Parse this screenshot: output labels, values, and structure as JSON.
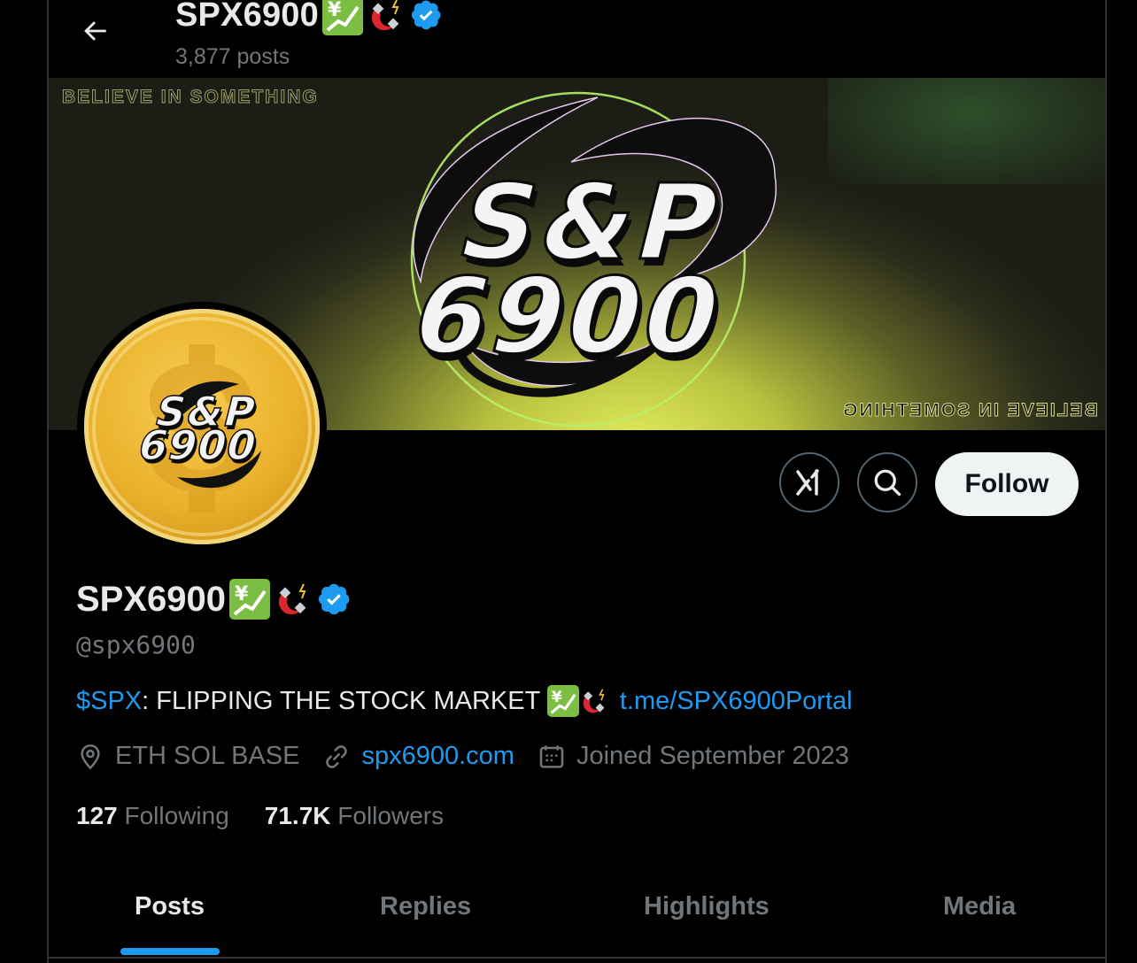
{
  "header": {
    "back_icon": "arrow-left-icon",
    "title": "SPX6900",
    "posts_count": "3,877 posts"
  },
  "banner": {
    "text_top": "BELIEVE IN SOMETHING",
    "text_bottom": "BELIEVE IN SOMETHING",
    "logo_line1": "S&P",
    "logo_line2": "6900",
    "accent": "#dfe85a"
  },
  "avatar": {
    "logo_line1": "S&P",
    "logo_line2": "6900",
    "color": "#eab12b"
  },
  "actions": {
    "grok_icon": "grok-icon",
    "search_icon": "search-icon",
    "follow_label": "Follow"
  },
  "profile": {
    "display_name": "SPX6900",
    "handle": "@spx6900",
    "bio_ticker": "$SPX",
    "bio_text": ": FLIPPING THE STOCK MARKET ",
    "bio_link": "t.me/SPX6900Portal",
    "location": "ETH SOL BASE",
    "website": "spx6900.com",
    "joined": "Joined September 2023",
    "following_count": "127",
    "following_label": "Following",
    "followers_count": "71.7K",
    "followers_label": "Followers"
  },
  "tabs": [
    {
      "label": "Posts",
      "active": true
    },
    {
      "label": "Replies",
      "active": false
    },
    {
      "label": "Highlights",
      "active": false
    },
    {
      "label": "Media",
      "active": false
    }
  ],
  "colors": {
    "background": "#000000",
    "accent_blue": "#1d9bf0",
    "muted_text": "#71767b",
    "border": "#2f3336"
  }
}
